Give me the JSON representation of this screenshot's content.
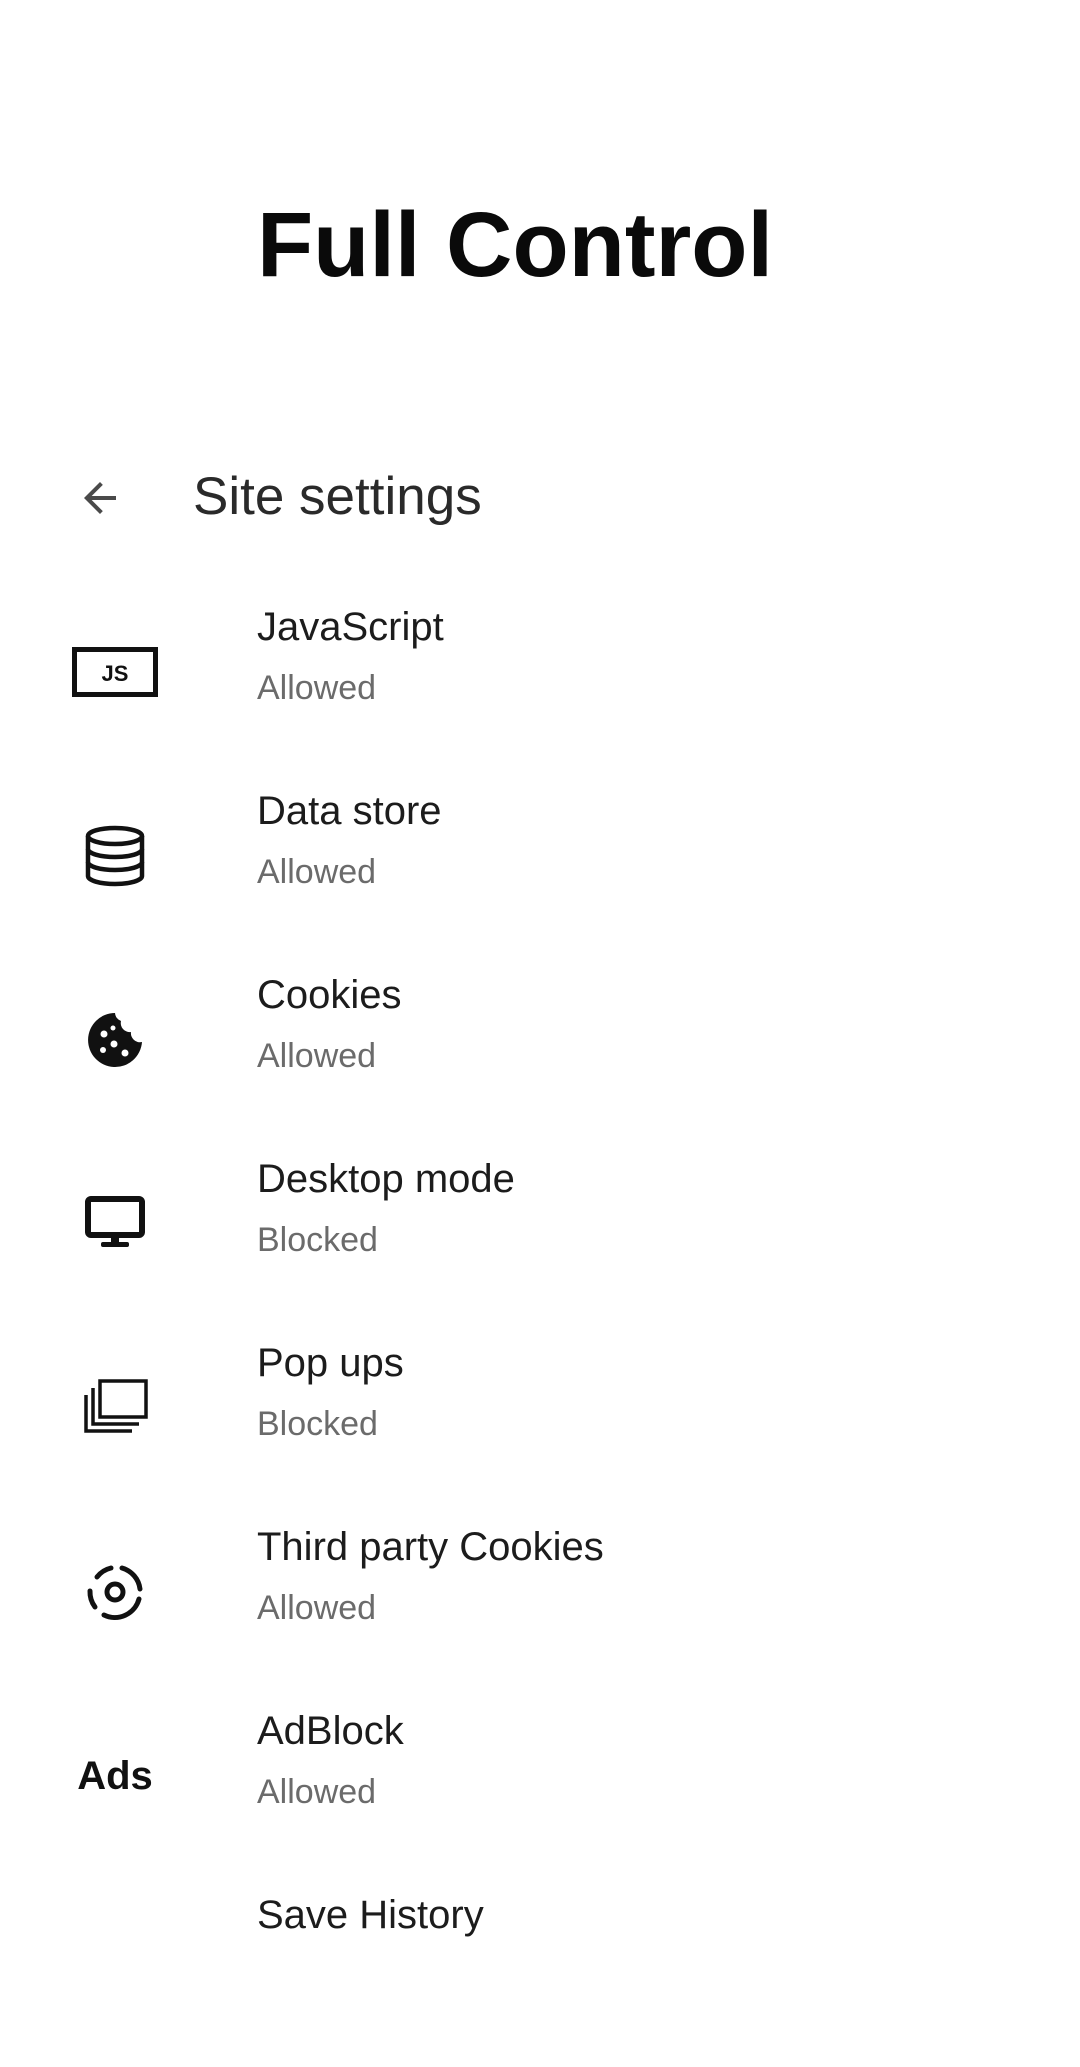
{
  "promo": {
    "title": "Full Control"
  },
  "app_bar": {
    "back_icon": "arrow-back-icon",
    "title": "Site settings"
  },
  "settings": [
    {
      "label": "JavaScript",
      "status": "Allowed",
      "icon": "javascript-icon",
      "icon_text": "JS"
    },
    {
      "label": "Data store",
      "status": "Allowed",
      "icon": "database-icon"
    },
    {
      "label": "Cookies",
      "status": "Allowed",
      "icon": "cookie-icon"
    },
    {
      "label": "Desktop mode",
      "status": "Blocked",
      "icon": "desktop-icon"
    },
    {
      "label": "Pop ups",
      "status": "Blocked",
      "icon": "popup-windows-icon"
    },
    {
      "label": "Third party Cookies",
      "status": "Allowed",
      "icon": "third-party-cookie-icon"
    },
    {
      "label": "AdBlock",
      "status": "Allowed",
      "icon": "ads-icon",
      "icon_text": "Ads"
    },
    {
      "label": "Save History",
      "status": "",
      "icon": "history-icon"
    }
  ],
  "colors": {
    "background": "#ffffff",
    "title_text": "#0a0a0a",
    "label_text": "#1c1c1c",
    "status_text": "#6b6b6b"
  }
}
